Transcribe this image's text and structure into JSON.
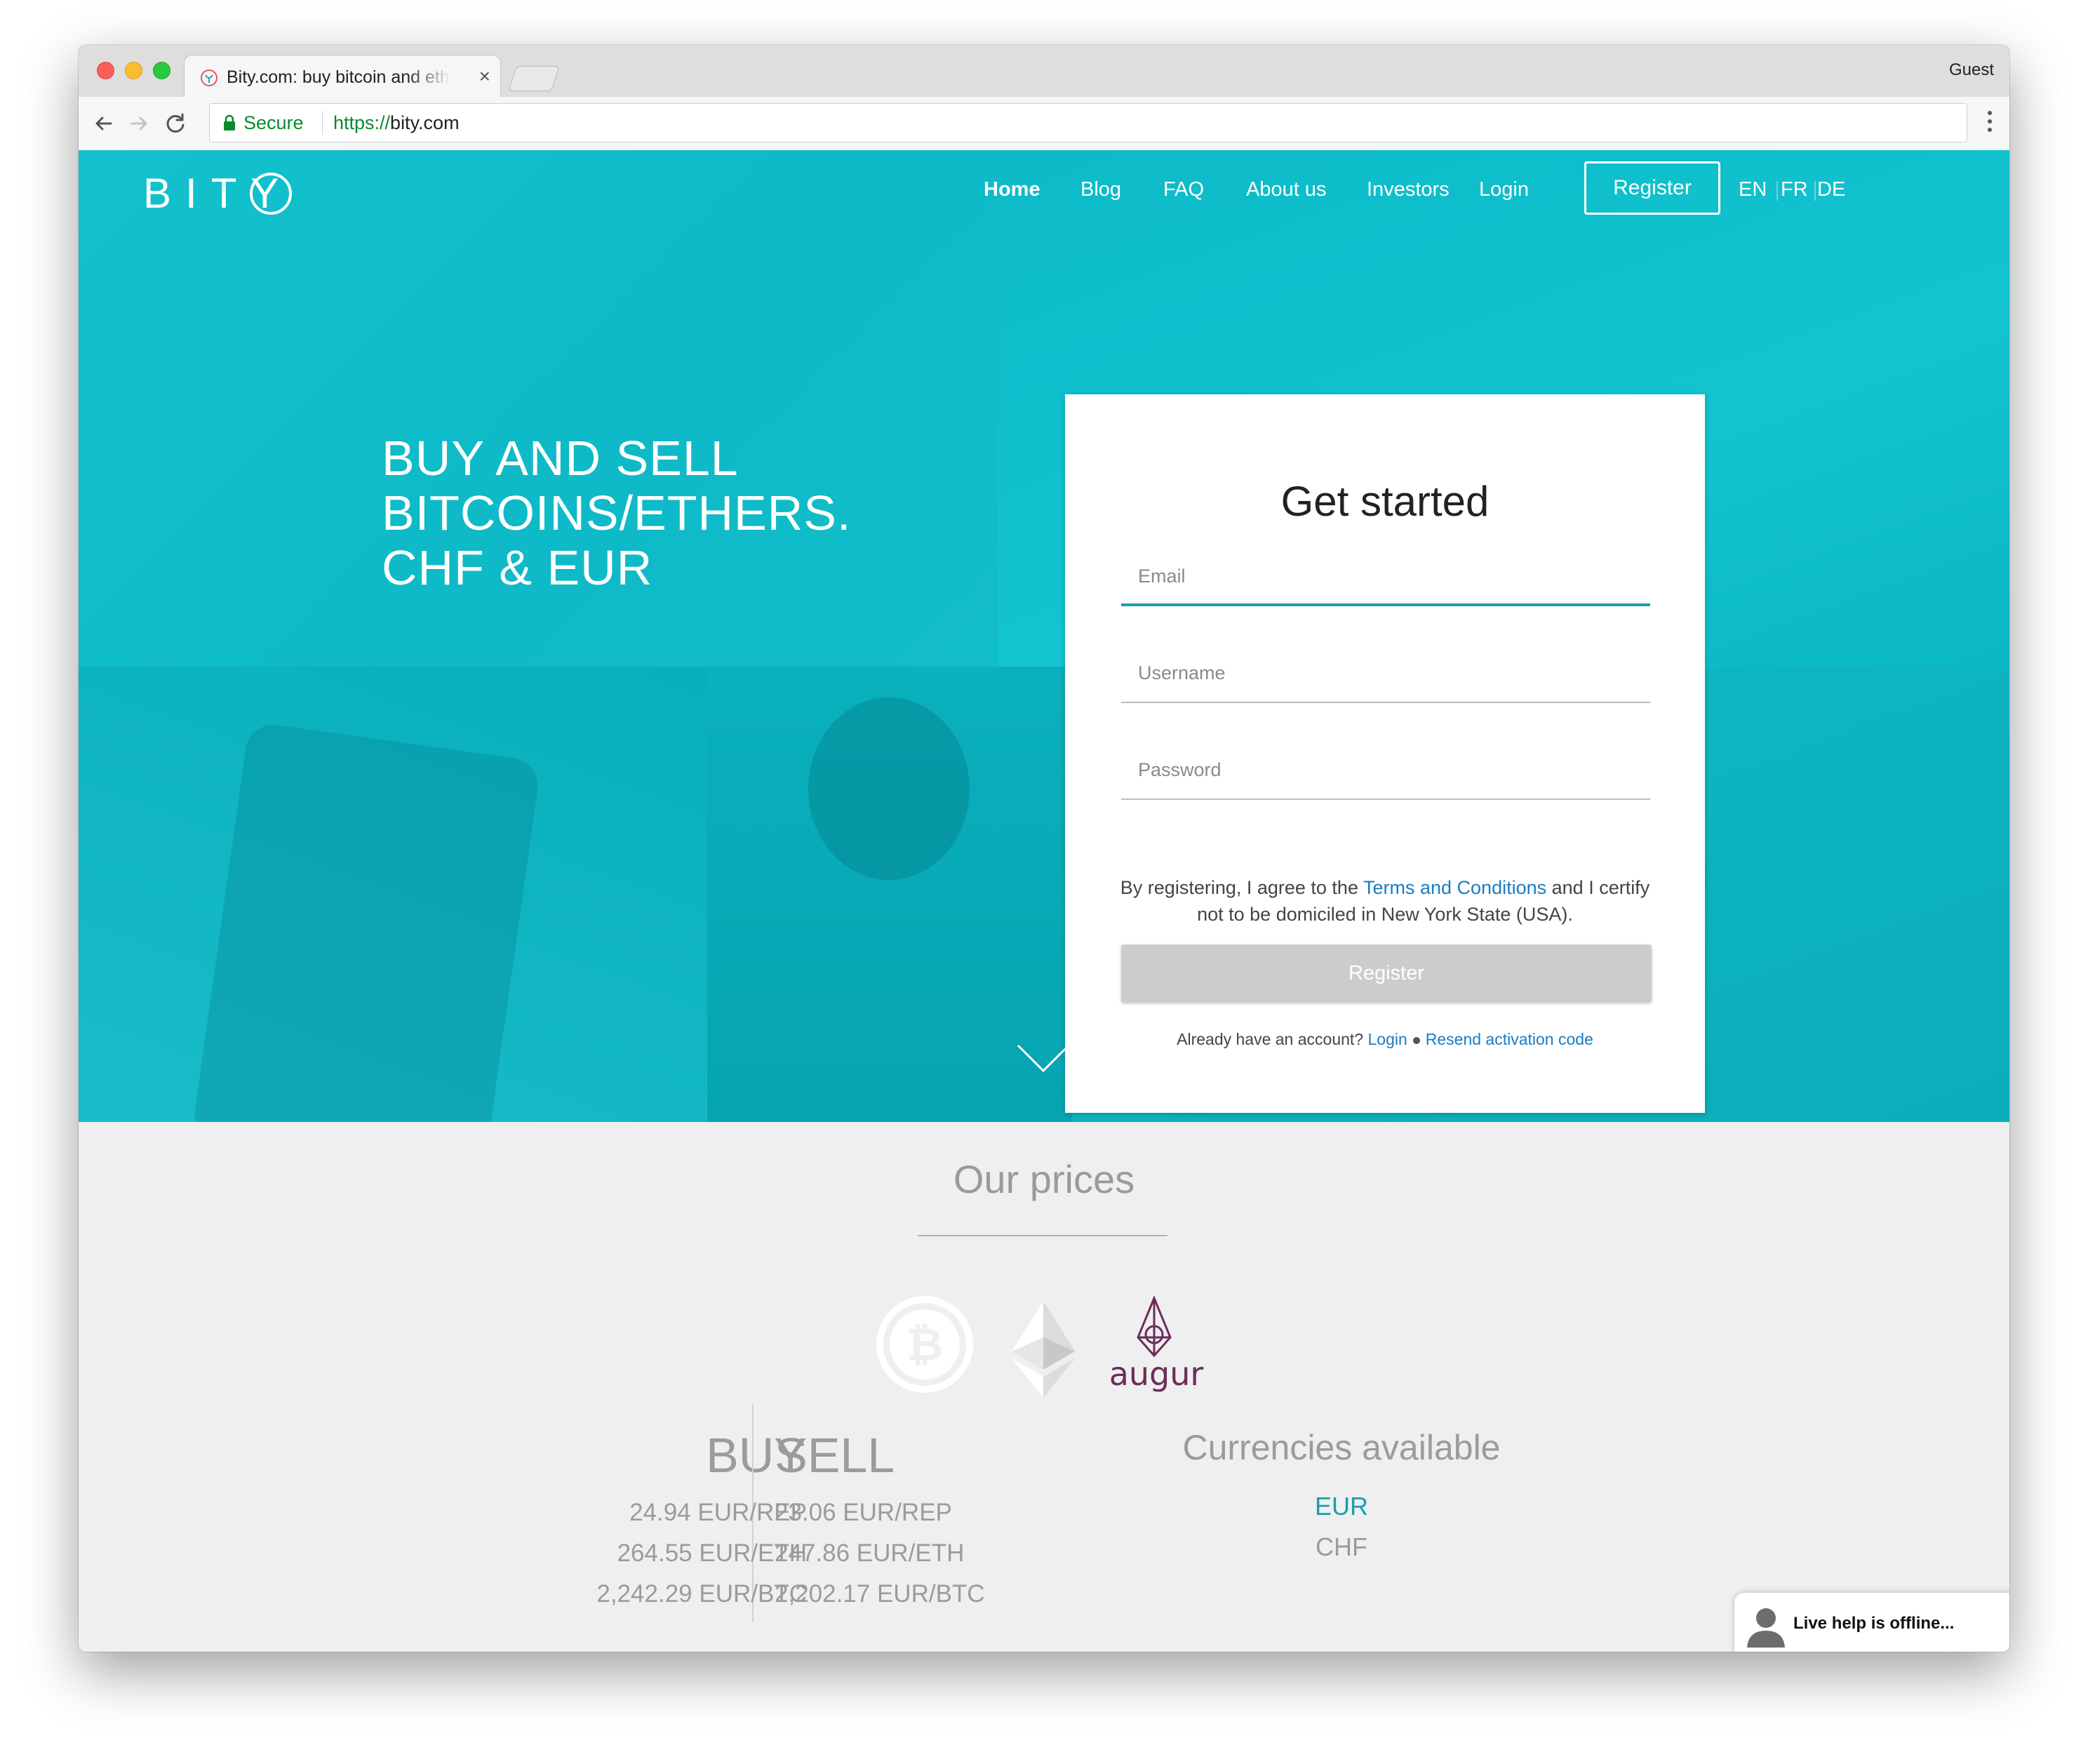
{
  "browser": {
    "tab_title": "Bity.com: buy bitcoin and ethers",
    "close_glyph": "×",
    "profile": "Guest",
    "security_label": "Secure",
    "url_scheme": "https://",
    "url_host": "bity.com"
  },
  "site": {
    "logo_text": "BITY",
    "nav": [
      "Home",
      "Blog",
      "FAQ",
      "About us",
      "Investors",
      "Login"
    ],
    "register_label": "Register",
    "languages": [
      "EN",
      "FR",
      "DE"
    ]
  },
  "hero": {
    "headline": [
      "BUY AND SELL",
      "BITCOINS/ETHERS.",
      "CHF & EUR"
    ]
  },
  "signup": {
    "title": "Get started",
    "email_placeholder": "Email",
    "username_placeholder": "Username",
    "password_placeholder": "Password",
    "terms_before": "By registering, I agree to the",
    "terms_link": "Terms and Conditions",
    "terms_after": "and I certify not to be domiciled in New York State (USA).",
    "register_button": "Register",
    "already_text": "Already have an account?",
    "login_link": "Login",
    "resend_link": "Resend activation code"
  },
  "prices": {
    "title": "Our prices",
    "coins": [
      "bitcoin-icon",
      "ethereum-icon",
      "augur-icon"
    ],
    "augur_label": "augur",
    "buy_header": "BUY",
    "sell_header": "SELL",
    "buy": [
      "24.94 EUR/REP",
      "264.55 EUR/ETH",
      "2,242.29 EUR/BTC"
    ],
    "sell": [
      "23.06 EUR/REP",
      "247.86 EUR/ETH",
      "2,202.17 EUR/BTC"
    ],
    "currencies_header": "Currencies available",
    "currencies": [
      "EUR",
      "CHF"
    ],
    "selected_currency": "EUR"
  },
  "livehelp": {
    "label": "Live help is offline..."
  },
  "colors": {
    "brand_teal": "#0bbfcc",
    "link_blue": "#1a7cc4",
    "focus_teal": "#1a9fae",
    "augur_purple": "#6b2d5c",
    "secure_green": "#0a8a2f"
  }
}
